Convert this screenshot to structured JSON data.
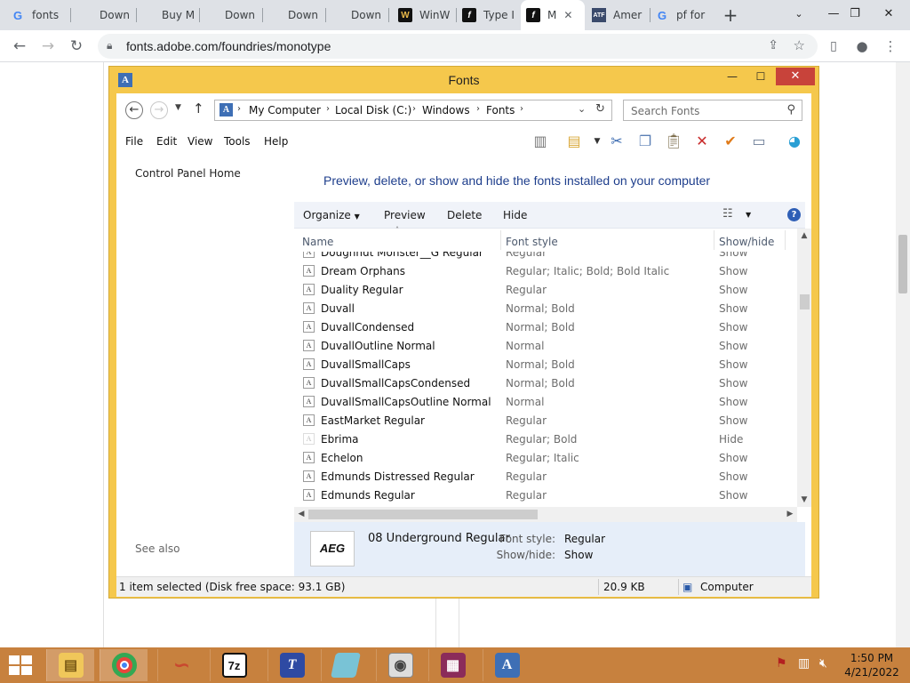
{
  "browser": {
    "tabs": [
      {
        "label": "fonts",
        "icon": "google-icon"
      },
      {
        "label": "Down",
        "icon": "microsoft-icon"
      },
      {
        "label": "Buy M",
        "icon": "microsoft-icon"
      },
      {
        "label": "Down",
        "icon": "microsoft-icon"
      },
      {
        "label": "Down",
        "icon": "microsoft-icon"
      },
      {
        "label": "Down",
        "icon": "microsoft-icon"
      },
      {
        "label": "WinW",
        "icon": "winworld-icon"
      },
      {
        "label": "Type I",
        "icon": "typekit-icon"
      },
      {
        "label": "M",
        "icon": "typekit-icon",
        "active": true
      },
      {
        "label": "Amer",
        "icon": "atf-icon"
      },
      {
        "label": "pf for",
        "icon": "google-icon"
      }
    ],
    "url": "fonts.adobe.com/foundries/monotype"
  },
  "explorer": {
    "title": "Fonts",
    "breadcrumb": [
      "My Computer",
      "Local Disk (C:)",
      "Windows",
      "Fonts"
    ],
    "search_placeholder": "Search Fonts",
    "menu": [
      "File",
      "Edit",
      "View",
      "Tools",
      "Help"
    ],
    "left": {
      "control_panel_home": "Control Panel Home",
      "see_also": "See also"
    },
    "heading": "Preview, delete, or show and hide the fonts installed on your computer",
    "commands": {
      "organize": "Organize",
      "preview": "Preview",
      "delete": "Delete",
      "hide": "Hide"
    },
    "columns": {
      "name": "Name",
      "style": "Font style",
      "showhide": "Show/hide"
    },
    "fonts": [
      {
        "name": "Doughnut Monster__G Regular",
        "style": "Regular",
        "show": "Show"
      },
      {
        "name": "Dream Orphans",
        "style": "Regular; Italic; Bold; Bold Italic",
        "show": "Show"
      },
      {
        "name": "Duality Regular",
        "style": "Regular",
        "show": "Show"
      },
      {
        "name": "Duvall",
        "style": "Normal; Bold",
        "show": "Show"
      },
      {
        "name": "DuvallCondensed",
        "style": "Normal; Bold",
        "show": "Show"
      },
      {
        "name": "DuvallOutline Normal",
        "style": "Normal",
        "show": "Show"
      },
      {
        "name": "DuvallSmallCaps",
        "style": "Normal; Bold",
        "show": "Show"
      },
      {
        "name": "DuvallSmallCapsCondensed",
        "style": "Normal; Bold",
        "show": "Show"
      },
      {
        "name": "DuvallSmallCapsOutline Normal",
        "style": "Normal",
        "show": "Show"
      },
      {
        "name": "EastMarket Regular",
        "style": "Regular",
        "show": "Show"
      },
      {
        "name": "Ebrima",
        "style": "Regular; Bold",
        "show": "Hide"
      },
      {
        "name": "Echelon",
        "style": "Regular; Italic",
        "show": "Show"
      },
      {
        "name": "Edmunds Distressed Regular",
        "style": "Regular",
        "show": "Show"
      },
      {
        "name": "Edmunds Regular",
        "style": "Regular",
        "show": "Show"
      }
    ],
    "details": {
      "thumb_text": "AEG",
      "name": "08 Underground Regular",
      "style_label": "Font style:",
      "style_value": "Regular",
      "show_label": "Show/hide:",
      "show_value": "Show"
    },
    "status": {
      "selected": "1 item selected (Disk free space: 93.1 GB)",
      "size": "20.9 KB",
      "location": "Computer"
    }
  },
  "clock": {
    "time": "1:50 PM",
    "date": "4/21/2022"
  },
  "colors": {
    "window_frame": "#f5c84c",
    "taskbar": "#c7813e",
    "heading": "#1e3e8c"
  }
}
